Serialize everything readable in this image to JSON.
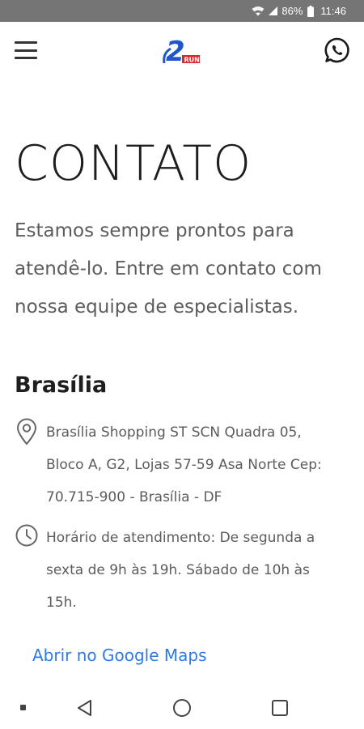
{
  "status_bar": {
    "battery": "86%",
    "time": "11:46",
    "icons": [
      "wifi-icon",
      "signal-icon",
      "battery-icon"
    ]
  },
  "header": {
    "menu_icon": "hamburger-menu-icon",
    "logo_text": "2",
    "logo_subtext": "RUN",
    "whatsapp_icon": "whatsapp-icon"
  },
  "page": {
    "title": "CONTATO",
    "intro_lines": [
      "Estamos sempre prontos para",
      "atendê-lo. Entre em contato com",
      "nossa equipe de especialistas."
    ]
  },
  "location": {
    "city": "Brasília",
    "address_lines": [
      "Brasília Shopping ST SCN Quadra 05,",
      "Bloco A, G2, Lojas 57-59 Asa Norte Cep:",
      "70.715-900 - Brasília - DF"
    ],
    "hours_lines": [
      "Horário de atendimento: De segunda a",
      "sexta de 9h às 19h. Sábado de 10h às",
      "15h."
    ],
    "maps_link": "Abrir no Google Maps"
  },
  "colors": {
    "status_bar": "#757575",
    "link": "#2f7ae5",
    "logo_blue": "#1f56c9",
    "logo_red": "#e3242b",
    "body_text": "#5c5c5c"
  }
}
